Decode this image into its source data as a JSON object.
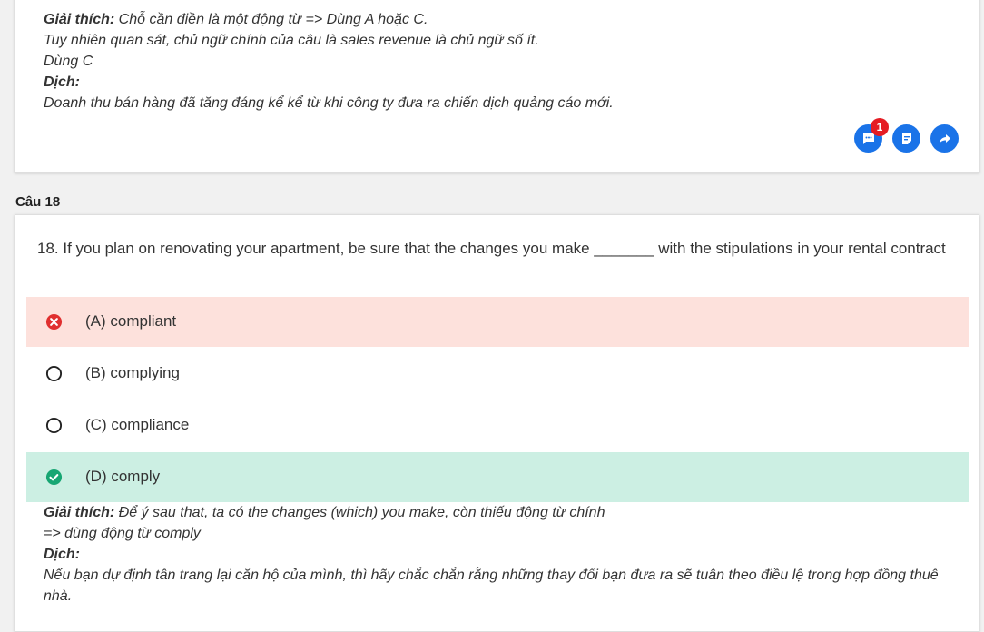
{
  "prev_question": {
    "explanation_label": "Giải thích:",
    "explanation_line1": " Chỗ cần điền là một động từ => Dùng A hoặc C.",
    "explanation_line2": "Tuy nhiên quan sát, chủ ngữ chính của câu là sales revenue là chủ ngữ số ít.",
    "explanation_line3": "Dùng C",
    "translation_label": "Dịch:",
    "translation_text": "Doanh thu bán hàng đã tăng đáng kể kể từ khi công ty đưa ra chiến dịch quảng cáo mới.",
    "comment_badge": "1"
  },
  "question": {
    "label": "Câu 18",
    "text": "18. If you plan on renovating your apartment, be sure that the changes you make _______ with the stipulations in your rental contract",
    "options": [
      {
        "label": "(A) compliant",
        "state": "wrong"
      },
      {
        "label": "(B) complying",
        "state": "unselected"
      },
      {
        "label": "(C) compliance",
        "state": "unselected"
      },
      {
        "label": "(D) comply",
        "state": "correct"
      }
    ],
    "explanation_label": "Giải thích:",
    "explanation_line1": " Để ý sau that, ta có the changes (which) you make, còn thiếu động từ chính",
    "explanation_line2": "=> dùng động từ comply",
    "translation_label": "Dịch:",
    "translation_text": "Nếu bạn dự định tân trang lại căn hộ của mình, thì hãy chắc chắn rằng những thay đổi bạn đưa ra sẽ tuân theo điều lệ trong hợp đồng thuê nhà."
  },
  "colors": {
    "accent": "#1a73e8",
    "wrong_bg": "#fde1dc",
    "correct_bg": "#ccefe3",
    "wrong_icon": "#e02f2f",
    "correct_icon": "#17a673",
    "badge": "#e51c23"
  },
  "icons": {
    "comment": "comment-icon",
    "note": "note-icon",
    "share": "share-icon"
  }
}
